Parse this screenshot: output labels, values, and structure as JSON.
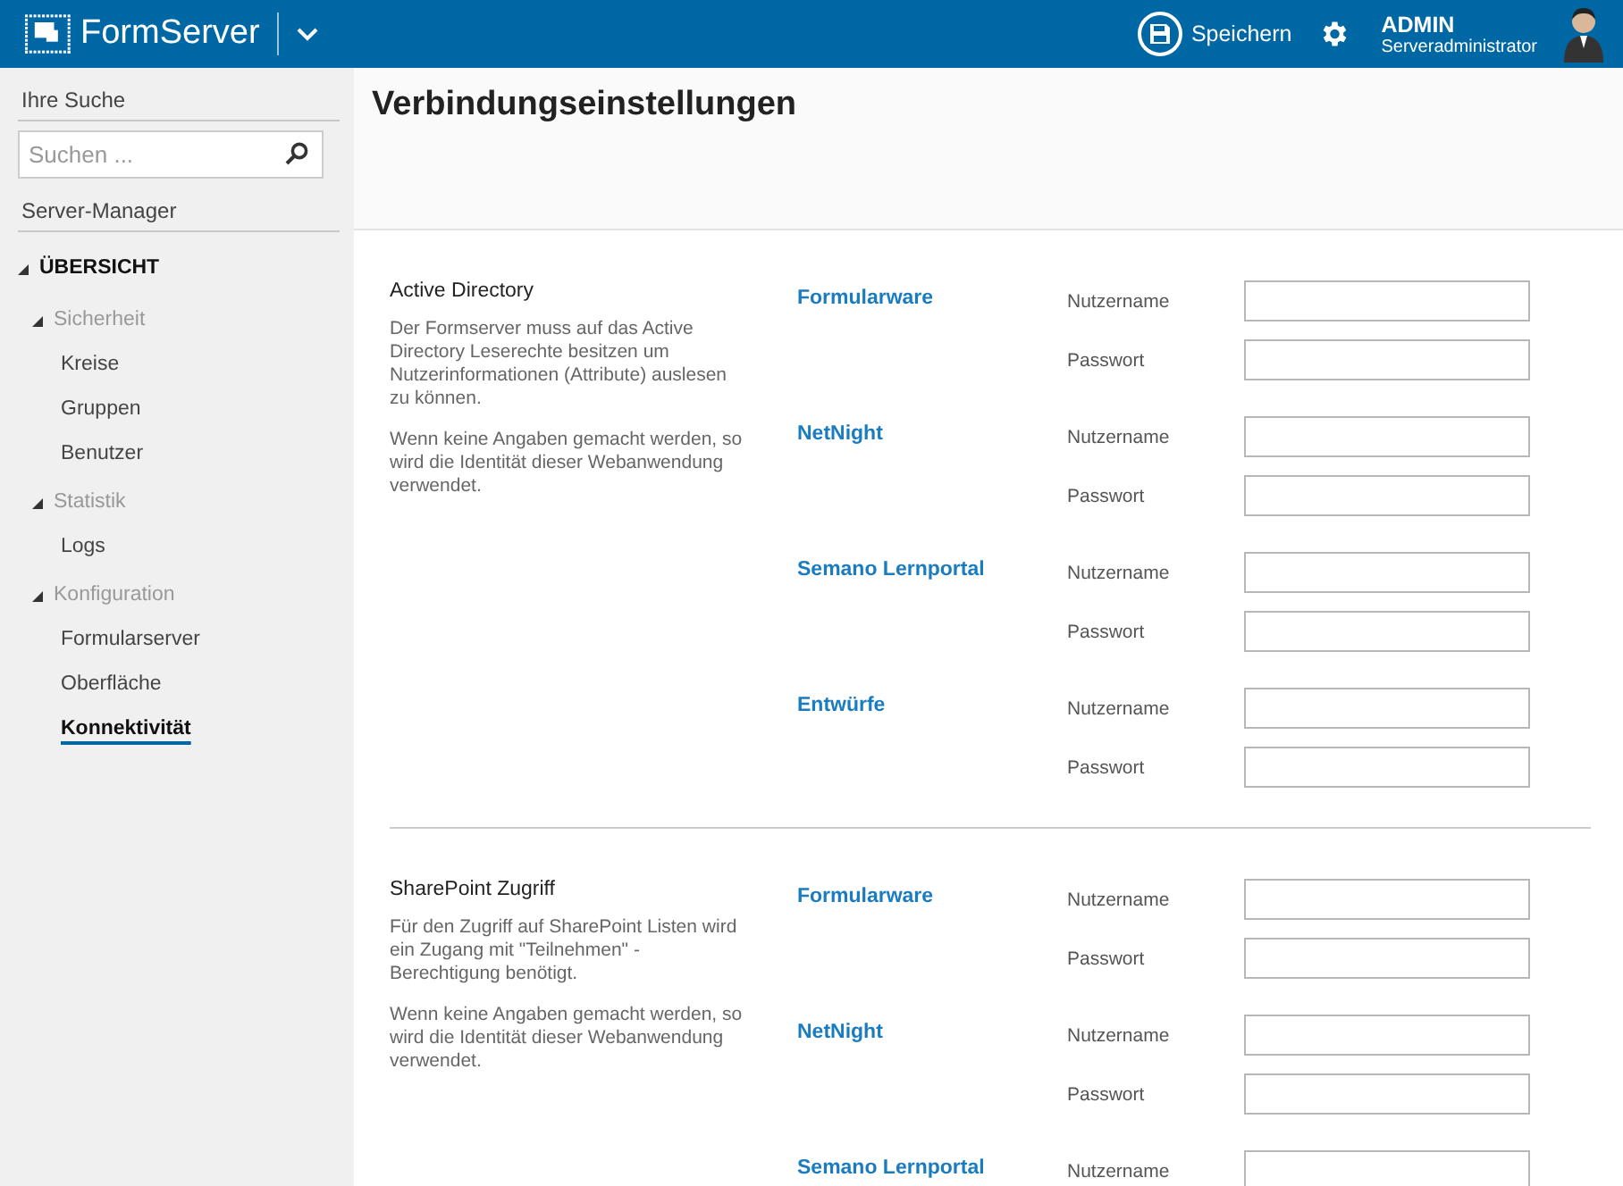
{
  "header": {
    "logo": "FormServer",
    "save": "Speichern",
    "user": {
      "name": "ADMIN",
      "role": "Serveradministrator"
    }
  },
  "sidebar": {
    "search_label": "Ihre Suche",
    "search": {
      "placeholder": "Suchen ..."
    },
    "section_label": "Server-Manager",
    "tree": [
      {
        "kind": "root",
        "label": "ÜBERSICHT",
        "expanded": true,
        "children": [
          {
            "kind": "group",
            "label": "Sicherheit",
            "expanded": true,
            "children": [
              {
                "kind": "leaf",
                "label": "Kreise",
                "selected": false
              },
              {
                "kind": "leaf",
                "label": "Gruppen",
                "selected": false
              },
              {
                "kind": "leaf",
                "label": "Benutzer",
                "selected": false
              }
            ]
          },
          {
            "kind": "group",
            "label": "Statistik",
            "expanded": true,
            "children": [
              {
                "kind": "leaf",
                "label": "Logs",
                "selected": false
              }
            ]
          },
          {
            "kind": "group",
            "label": "Konfiguration",
            "expanded": true,
            "children": [
              {
                "kind": "leaf",
                "label": "Formularserver",
                "selected": false
              },
              {
                "kind": "leaf",
                "label": "Oberfläche",
                "selected": false
              },
              {
                "kind": "leaf",
                "label": "Konnektivität",
                "selected": true
              }
            ]
          }
        ]
      }
    ]
  },
  "page_title": "Verbindungseinstellungen",
  "sections": [
    {
      "title": "Active Directory",
      "paragraphs": [
        "Der Formserver muss auf das Active Directory Leserechte besitzen um Nutzerinformationen (Attribute) auslesen zu können.",
        "Wenn keine Angaben gemacht werden, so wird die Identität dieser Webanwendung verwendet."
      ],
      "groups": [
        {
          "name": "Formularware",
          "fields": [
            "Nutzername",
            "Passwort"
          ]
        },
        {
          "name": "NetNight",
          "fields": [
            "Nutzername",
            "Passwort"
          ]
        },
        {
          "name": "Semano Lernportal",
          "fields": [
            "Nutzername",
            "Passwort"
          ]
        },
        {
          "name": "Entwürfe",
          "fields": [
            "Nutzername",
            "Passwort"
          ]
        }
      ]
    },
    {
      "title": "SharePoint Zugriff",
      "paragraphs": [
        "Für den Zugriff auf SharePoint Listen wird ein Zugang mit \"Teilnehmen\" - Berechtigung benötigt.",
        "Wenn keine Angaben gemacht werden, so wird die Identität dieser Webanwendung verwendet."
      ],
      "groups": [
        {
          "name": "Formularware",
          "fields": [
            "Nutzername",
            "Passwort"
          ]
        },
        {
          "name": "NetNight",
          "fields": [
            "Nutzername",
            "Passwort"
          ]
        },
        {
          "name": "Semano Lernportal",
          "fields": [
            "Nutzername"
          ]
        }
      ]
    }
  ]
}
